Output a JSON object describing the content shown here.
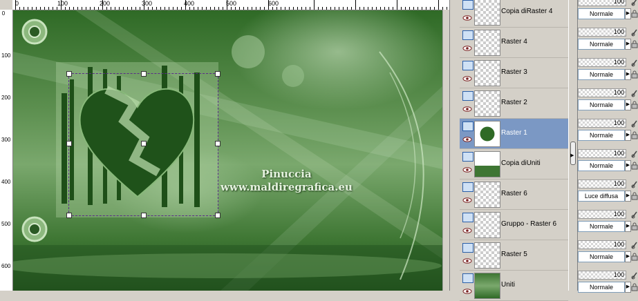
{
  "ruler_top": {
    "labels": [
      "0",
      "100",
      "200",
      "300",
      "400",
      "500",
      "600"
    ]
  },
  "ruler_left": {
    "labels": [
      "0",
      "100",
      "200",
      "300",
      "400",
      "500",
      "600"
    ]
  },
  "watermark": {
    "line1": "Pinuccia",
    "line2": "www.maldiregrafica.eu"
  },
  "layers": [
    {
      "name": "Copia diRaster 4",
      "opacity": "100",
      "blend": "Normale",
      "selected": false
    },
    {
      "name": "Raster 4",
      "opacity": "100",
      "blend": "Normale",
      "selected": false
    },
    {
      "name": "Raster 3",
      "opacity": "100",
      "blend": "Normale",
      "selected": false
    },
    {
      "name": "Raster 2",
      "opacity": "100",
      "blend": "Normale",
      "selected": false
    },
    {
      "name": "Raster 1",
      "opacity": "100",
      "blend": "Normale",
      "selected": true
    },
    {
      "name": "Copia diUniti",
      "opacity": "100",
      "blend": "Normale",
      "selected": false
    },
    {
      "name": "Raster 6",
      "opacity": "100",
      "blend": "Luce diffusa",
      "selected": false
    },
    {
      "name": "Gruppo - Raster 6",
      "opacity": "100",
      "blend": "Normale",
      "selected": false
    },
    {
      "name": "Raster 5",
      "opacity": "100",
      "blend": "Normale",
      "selected": false
    },
    {
      "name": "Uniti",
      "opacity": "100",
      "blend": "Normale",
      "selected": false
    }
  ],
  "colors": {
    "selected_row": "#7b98c4",
    "panel_bg": "#d4d0c8",
    "image_green": "#3e7633"
  }
}
